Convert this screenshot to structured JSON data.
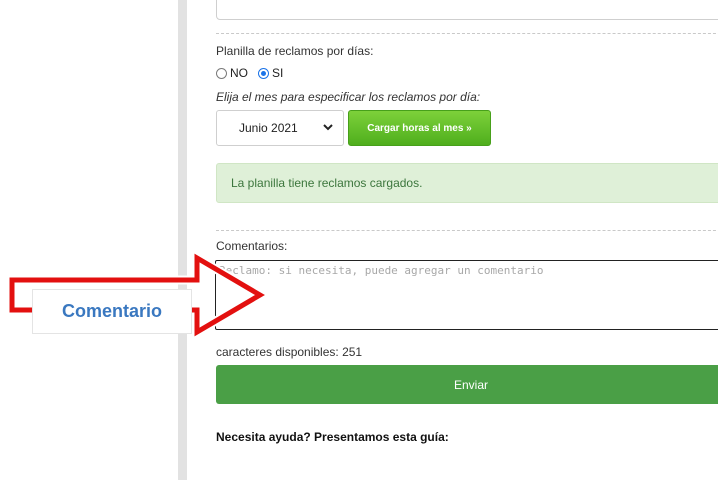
{
  "form": {
    "planilla_label": "Planilla de reclamos por días:",
    "radio_no": "NO",
    "radio_si": "SI",
    "radio_selected": "SI",
    "month_prompt": "Elija el mes para especificar los reclamos por día:",
    "month_selected": "Junio 2021",
    "load_button": "Cargar horas al mes »",
    "alert_text": "La planilla tiene reclamos cargados.",
    "comments_label": "Comentarios:",
    "comments_placeholder": "Reclamo: si necesita, puede agregar un comentario",
    "chars_available_label": "caracteres disponibles: 251",
    "send_button": "Enviar",
    "help_text": "Necesita ayuda? Presentamos esta guía:"
  },
  "annotation": {
    "callout_text": "Comentario",
    "arrow_color": "#e3100f",
    "label_color": "#3a78c0"
  },
  "colors": {
    "load_button": "#5cb82a",
    "send_button": "#4a9f46",
    "alert_bg": "#dff0d8",
    "alert_text": "#3c763d"
  }
}
